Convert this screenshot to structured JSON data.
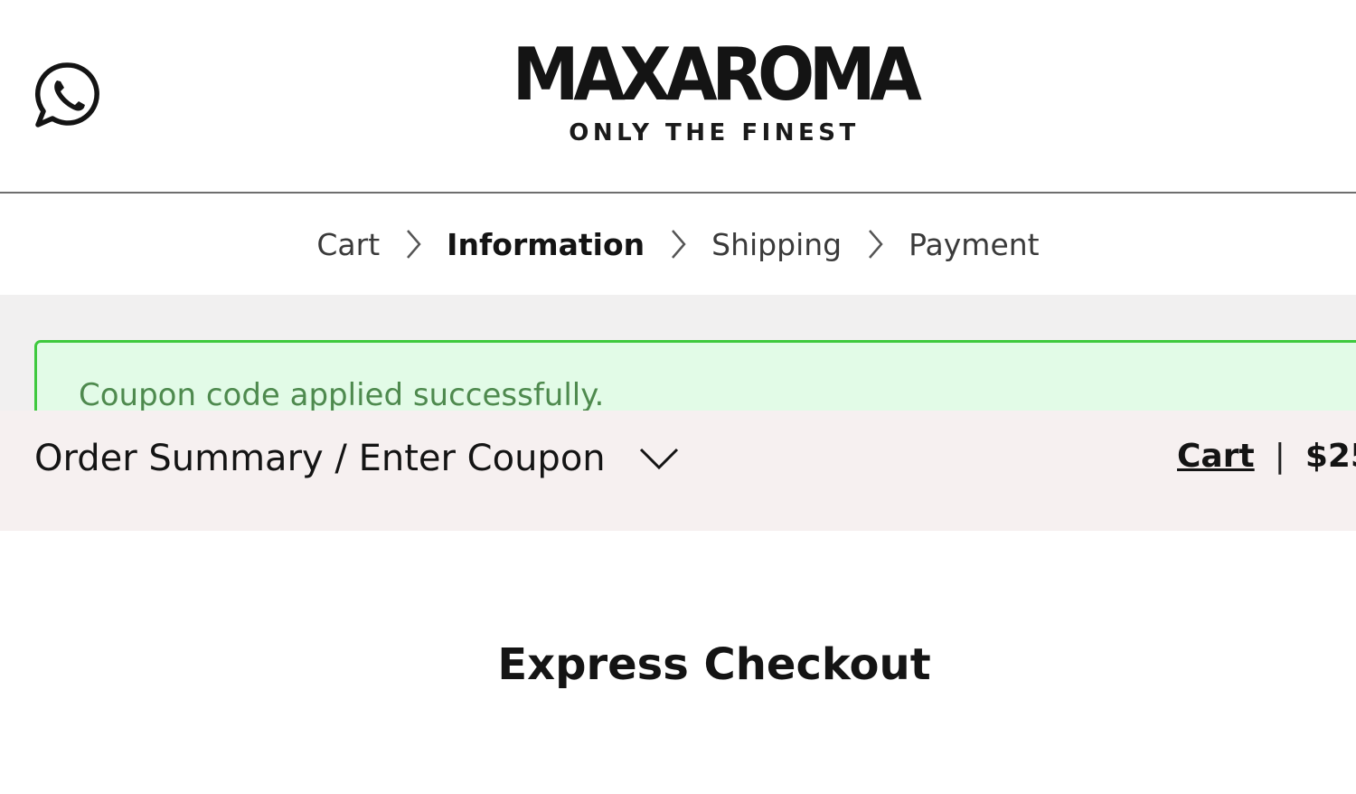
{
  "header": {
    "whatsapp_icon": "whatsapp-icon",
    "logo_text": "MAXAROMA",
    "logo_tagline": "ONLY THE FINEST"
  },
  "breadcrumb": {
    "items": [
      {
        "label": "Cart",
        "active": false
      },
      {
        "label": "Information",
        "active": true
      },
      {
        "label": "Shipping",
        "active": false
      },
      {
        "label": "Payment",
        "active": false
      }
    ],
    "separator_icon": "chevron-right-icon"
  },
  "alert": {
    "message": "Coupon code applied successfully.",
    "colors": {
      "background": "#e2fbe7",
      "border": "#3ec93e",
      "text": "#4e8a4e"
    }
  },
  "order_summary": {
    "toggle_label": "Order Summary / Enter Coupon",
    "toggle_icon": "chevron-down-icon",
    "cart_link": "Cart",
    "separator": "|",
    "total_visible": "$25"
  },
  "main": {
    "express_checkout_title": "Express Checkout"
  }
}
